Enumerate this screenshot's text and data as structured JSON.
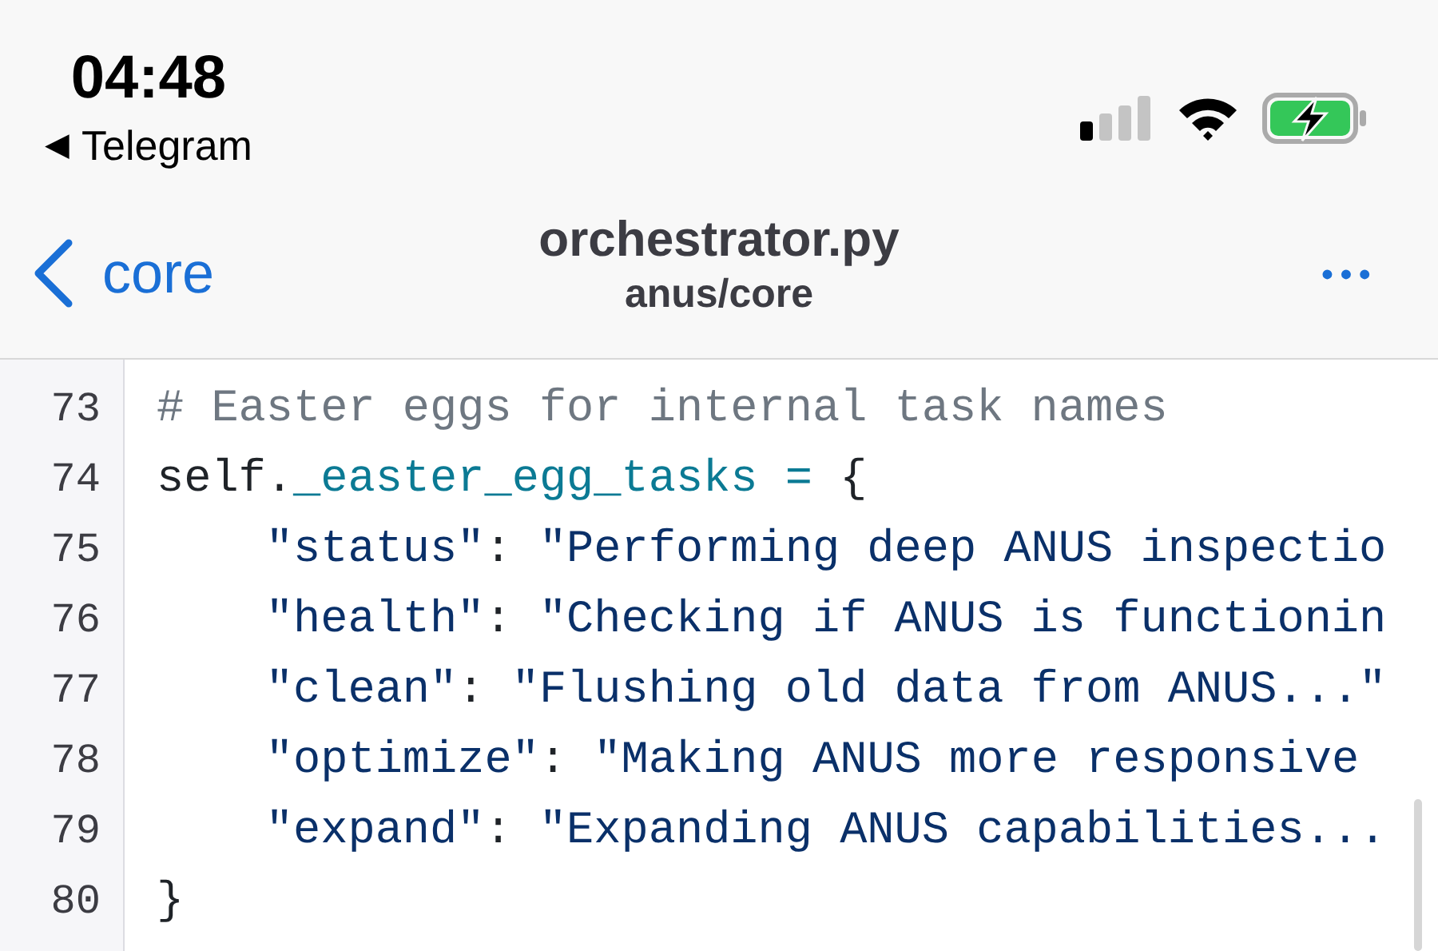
{
  "status_bar": {
    "time": "04:48",
    "back_app_arrow": "◀",
    "back_app": "Telegram"
  },
  "nav": {
    "back_label": "core",
    "title": "orchestrator.py",
    "subtitle": "anus/core",
    "more": "•••"
  },
  "code": [
    {
      "number": "73",
      "tokens": [
        {
          "kind": "comment",
          "text": "# Easter eggs for internal task names"
        }
      ]
    },
    {
      "number": "74",
      "tokens": [
        {
          "kind": "plain",
          "text": "self."
        },
        {
          "kind": "attr",
          "text": "_easter_egg_tasks ="
        },
        {
          "kind": "plain",
          "text": " {"
        }
      ]
    },
    {
      "number": "75",
      "tokens": [
        {
          "kind": "string",
          "text": "    \"status\""
        },
        {
          "kind": "plain",
          "text": ": "
        },
        {
          "kind": "string",
          "text": "\"Performing deep ANUS inspectio"
        }
      ]
    },
    {
      "number": "76",
      "tokens": [
        {
          "kind": "string",
          "text": "    \"health\""
        },
        {
          "kind": "plain",
          "text": ": "
        },
        {
          "kind": "string",
          "text": "\"Checking if ANUS is functionin"
        }
      ]
    },
    {
      "number": "77",
      "tokens": [
        {
          "kind": "string",
          "text": "    \"clean\""
        },
        {
          "kind": "plain",
          "text": ": "
        },
        {
          "kind": "string",
          "text": "\"Flushing old data from ANUS...\""
        }
      ]
    },
    {
      "number": "78",
      "tokens": [
        {
          "kind": "string",
          "text": "    \"optimize\""
        },
        {
          "kind": "plain",
          "text": ": "
        },
        {
          "kind": "string",
          "text": "\"Making ANUS more responsive"
        }
      ]
    },
    {
      "number": "79",
      "tokens": [
        {
          "kind": "string",
          "text": "    \"expand\""
        },
        {
          "kind": "plain",
          "text": ": "
        },
        {
          "kind": "string",
          "text": "\"Expanding ANUS capabilities..."
        }
      ]
    },
    {
      "number": "80",
      "tokens": [
        {
          "kind": "plain",
          "text": "}"
        }
      ]
    }
  ]
}
